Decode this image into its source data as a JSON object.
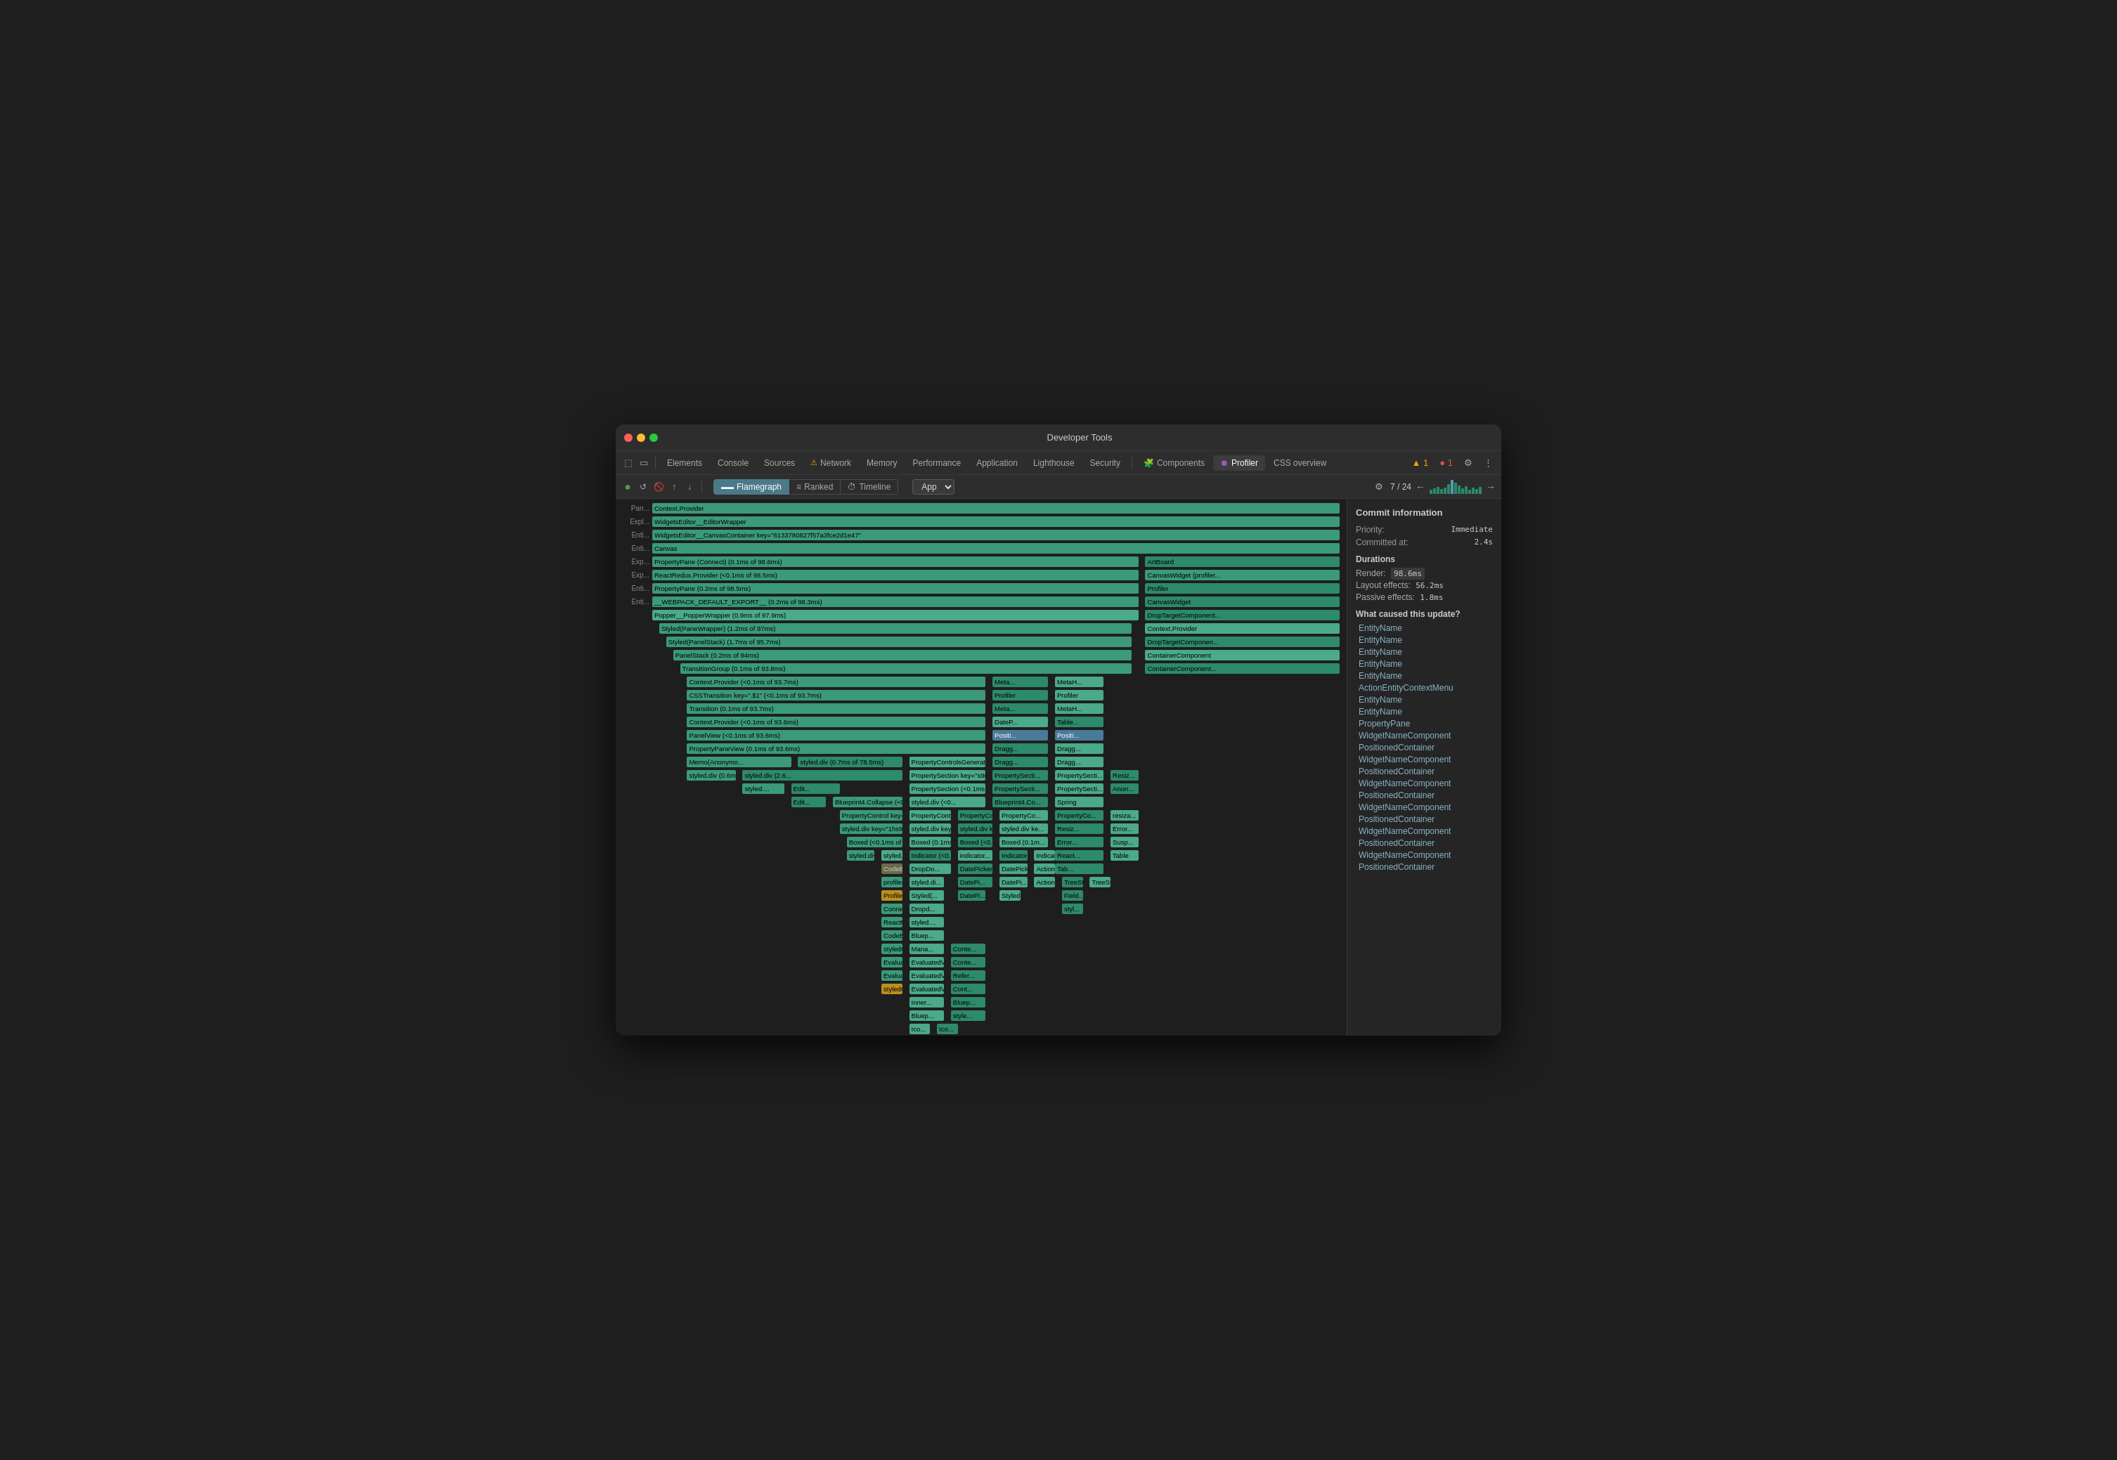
{
  "window": {
    "title": "Developer Tools"
  },
  "toolbar": {
    "tabs": [
      {
        "label": "Elements",
        "active": false,
        "icon": ""
      },
      {
        "label": "Console",
        "active": false,
        "icon": ""
      },
      {
        "label": "Sources",
        "active": false,
        "icon": ""
      },
      {
        "label": "Network",
        "active": false,
        "icon": "⚠",
        "hasWarning": true
      },
      {
        "label": "Memory",
        "active": false,
        "icon": ""
      },
      {
        "label": "Performance",
        "active": false,
        "icon": ""
      },
      {
        "label": "Application",
        "active": false,
        "icon": ""
      },
      {
        "label": "Lighthouse",
        "active": false,
        "icon": ""
      },
      {
        "label": "Security",
        "active": false,
        "icon": ""
      },
      {
        "label": "Components",
        "active": false,
        "icon": "🧩"
      },
      {
        "label": "Profiler",
        "active": true,
        "icon": "⏺"
      },
      {
        "label": "CSS overview",
        "active": false,
        "icon": ""
      }
    ],
    "warning_count": "▲ 1",
    "error_count": "🔴 1"
  },
  "profiler_toolbar": {
    "tabs": [
      {
        "label": "Flamegraph",
        "active": true,
        "icon": "▬"
      },
      {
        "label": "Ranked",
        "active": false,
        "icon": "≡"
      },
      {
        "label": "Timeline",
        "active": false,
        "icon": "⏱"
      }
    ],
    "app_select": "App",
    "nav": {
      "current": "7",
      "total": "24"
    }
  },
  "flamegraph": {
    "rows": [
      {
        "label": "Pan...",
        "name": "Context.Provider",
        "color": "teal",
        "level": 0,
        "width": "95%",
        "left": "0%"
      },
      {
        "label": "Expl...",
        "name": "WidgetsEditor__EditorWrapper",
        "color": "teal",
        "level": 0,
        "width": "90%",
        "left": "0%"
      },
      {
        "label": "Enti...",
        "name": "WidgetsEditor__CanvasContainer key=\"6133780827f57a3fce2d1e47\"",
        "color": "teal",
        "level": 0,
        "width": "88%",
        "left": "0%"
      },
      {
        "label": "Enti...",
        "name": "Canvas",
        "color": "teal",
        "level": 0,
        "width": "85%",
        "left": "0%"
      },
      {
        "label": "Exp...",
        "name": "PropertyPane (Connect) (0.1ms of 98.6ms)",
        "color": "teal",
        "level": 0,
        "width": "60%",
        "left": "0%"
      },
      {
        "label": "Exp...",
        "name": "ReactRedux.Provider (<0.1ms of 98.5ms)",
        "color": "teal",
        "level": 0,
        "width": "60%",
        "left": "0%"
      },
      {
        "label": "Enti...",
        "name": "PropertyPane (0.2ms of 98.5ms)",
        "color": "teal",
        "level": 0,
        "width": "60%",
        "left": "0%"
      },
      {
        "label": "Enti...",
        "name": "__WEBPACK_DEFAULT_EXPORT__ (0.2ms of 98.3ms)",
        "color": "teal",
        "level": 0,
        "width": "60%",
        "left": "0%"
      }
    ]
  },
  "sidebar": {
    "title": "Commit information",
    "priority_label": "Priority:",
    "priority_value": "Immediate",
    "committed_at_label": "Committed at:",
    "committed_at_value": "2.4s",
    "durations_title": "Durations",
    "render_label": "Render:",
    "render_value": "98.6ms",
    "layout_label": "Layout effects:",
    "layout_value": "56.2ms",
    "passive_label": "Passive effects:",
    "passive_value": "1.8ms",
    "causes_title": "What caused this update?",
    "causes": [
      "EntityName",
      "EntityName",
      "EntityName",
      "EntityName",
      "EntityName",
      "ActionEntityContextMenu",
      "EntityName",
      "EntityName",
      "PropertyPane",
      "WidgetNameComponent",
      "PositionedContainer",
      "WidgetNameComponent",
      "PositionedContainer",
      "WidgetNameComponent",
      "PositionedContainer",
      "WidgetNameComponent",
      "PositionedContainer",
      "WidgetNameComponent",
      "PositionedContainer",
      "WidgetNameComponent",
      "PositionedContainer"
    ]
  }
}
